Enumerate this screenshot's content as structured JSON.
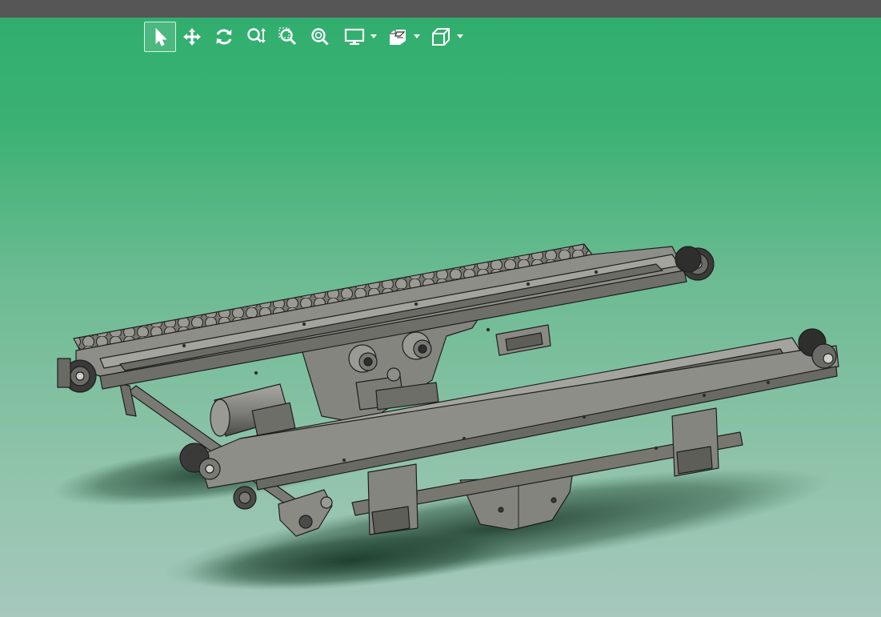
{
  "window": {
    "title_bar_text": ""
  },
  "toolbar": {
    "tools": [
      {
        "id": "select",
        "icon": "pointer-arrow-icon",
        "active": true
      },
      {
        "id": "pan",
        "icon": "move-arrows-icon",
        "active": false
      },
      {
        "id": "rotate",
        "icon": "rotate-icon",
        "active": false
      },
      {
        "id": "zoom-in-out",
        "icon": "zoom-in-out-icon",
        "active": false
      },
      {
        "id": "zoom-area",
        "icon": "zoom-area-icon",
        "active": false
      },
      {
        "id": "zoom-fit",
        "icon": "zoom-fit-icon",
        "active": false
      },
      {
        "id": "display-style",
        "icon": "monitor-icon",
        "has_dropdown": true
      },
      {
        "id": "section-view",
        "icon": "section-view-icon",
        "has_dropdown": true
      },
      {
        "id": "view-orientation",
        "icon": "cube-view-icon",
        "has_dropdown": true
      }
    ],
    "colors": {
      "icon": "#ffffff",
      "active_border": "#d9efe2"
    }
  },
  "viewport": {
    "model": "roller-conveyor-assembly",
    "colors": {
      "background_top": "#2fae6e",
      "background_bottom": "#a6c8bd",
      "part_fill": "#8a8a86",
      "part_dark": "#5a5a57",
      "part_edge": "#1e1e1e",
      "shadow": "#1f3a2c"
    }
  }
}
